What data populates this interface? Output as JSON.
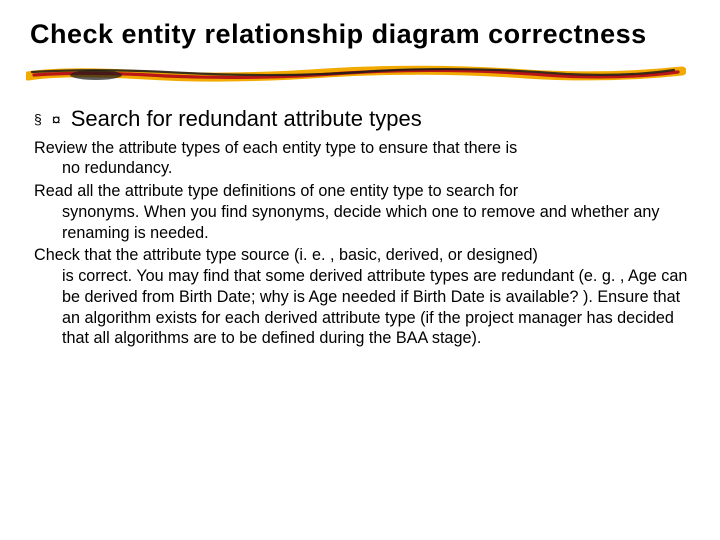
{
  "title": "Check entity relationship diagram correctness",
  "bullets": {
    "square": "§",
    "sun": "¤"
  },
  "subheading": "Search for redundant attribute types",
  "paragraphs": [
    {
      "first": "Review the attribute types of each entity type to ensure that there is",
      "rest": "no redundancy."
    },
    {
      "first": "Read all the attribute type definitions of one entity type to search for",
      "rest": "synonyms. When you find synonyms, decide which one to remove and whether any renaming is needed."
    },
    {
      "first": "Check that the attribute type source (i. e. , basic, derived, or designed)",
      "rest": "is correct. You may find that some derived attribute types are redundant (e. g. , Age can be derived from Birth Date; why is Age needed if Birth Date is available? ). Ensure that an algorithm exists for each derived attribute type (if the project manager has decided that all algorithms are to be defined during the BAA stage)."
    }
  ]
}
